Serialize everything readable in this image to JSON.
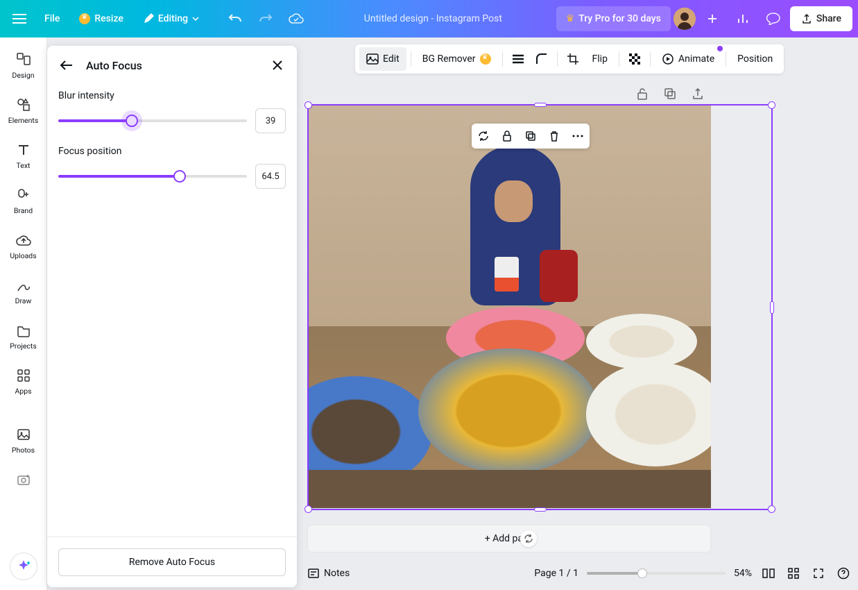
{
  "topbar": {
    "file": "File",
    "resize": "Resize",
    "editing": "Editing",
    "title": "Untitled design - Instagram Post",
    "trypro": "Try Pro for 30 days",
    "share": "Share"
  },
  "rail": {
    "items": [
      {
        "label": "Design"
      },
      {
        "label": "Elements"
      },
      {
        "label": "Text"
      },
      {
        "label": "Brand"
      },
      {
        "label": "Uploads"
      },
      {
        "label": "Draw"
      },
      {
        "label": "Projects"
      },
      {
        "label": "Apps"
      },
      {
        "label": "Photos"
      }
    ]
  },
  "panel": {
    "title": "Auto Focus",
    "blur_label": "Blur intensity",
    "blur_value": "39",
    "focus_label": "Focus position",
    "focus_value": "64.5",
    "remove": "Remove Auto Focus"
  },
  "ctx": {
    "edit": "Edit",
    "bgrem": "BG Remover",
    "flip": "Flip",
    "animate": "Animate",
    "position": "Position"
  },
  "addpage": "+ Add page",
  "bottom": {
    "notes": "Notes",
    "pageinfo": "Page 1 / 1",
    "zoom": "54%"
  },
  "colors": {
    "accent": "#8b3dff"
  }
}
